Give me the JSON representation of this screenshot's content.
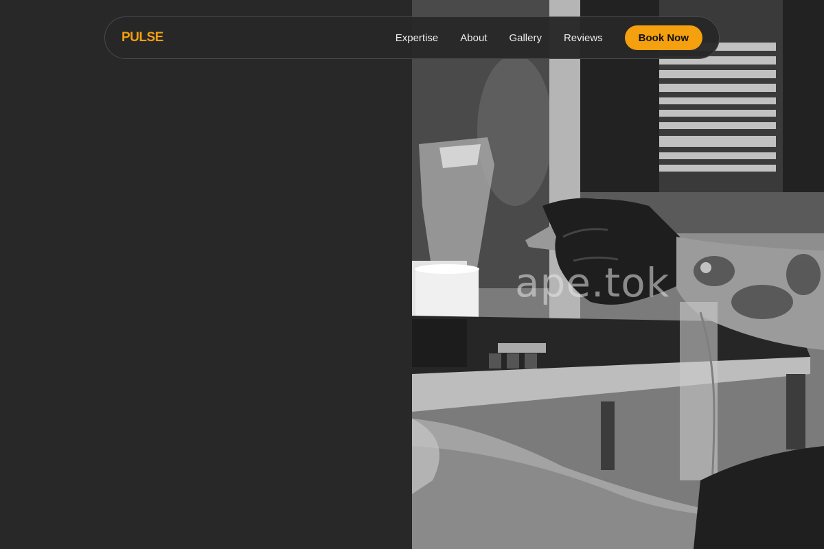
{
  "brand": {
    "logo_text": "PULSE",
    "accent_color": "#f5a00f"
  },
  "nav": {
    "links": [
      {
        "label": "Expertise"
      },
      {
        "label": "About"
      },
      {
        "label": "Gallery"
      },
      {
        "label": "Reviews"
      }
    ],
    "cta_label": "Book Now"
  },
  "hero": {
    "photo_subject": "black-and-white tattoo artist gloved hand holding tattoo machine over studio table",
    "watermark_text": "ape.tok"
  }
}
